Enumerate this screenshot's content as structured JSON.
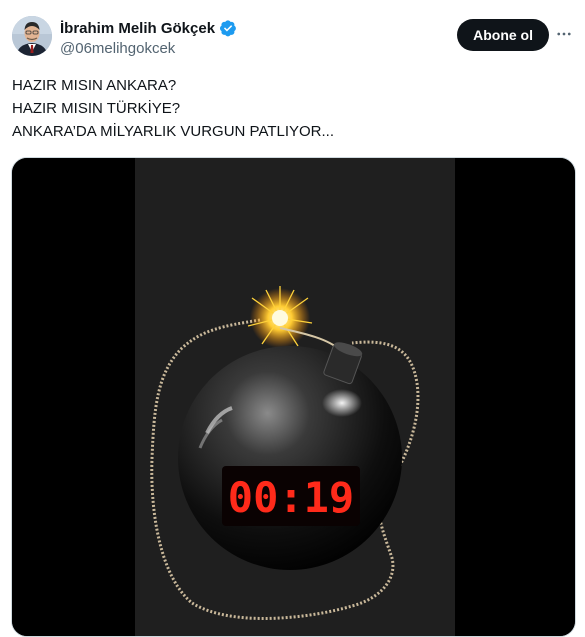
{
  "author": {
    "display_name": "İbrahim Melih Gökçek",
    "handle": "@06melihgokcek",
    "verified": true,
    "avatar_icon": "profile-photo"
  },
  "actions": {
    "follow_label": "Abone ol",
    "more_icon": "more-dots-icon"
  },
  "tweet": {
    "lines": [
      "HAZIR MISIN ANKARA?",
      "HAZIR MISIN TÜRKİYE?",
      "ANKARA’DA MİLYARLIK VURGUN PATLIYOR..."
    ]
  },
  "media": {
    "timer_display": "00:19",
    "accent_colors": {
      "timer": "#ff2a1a",
      "verified": "#1d9bf0",
      "button": "#0f1419"
    }
  }
}
